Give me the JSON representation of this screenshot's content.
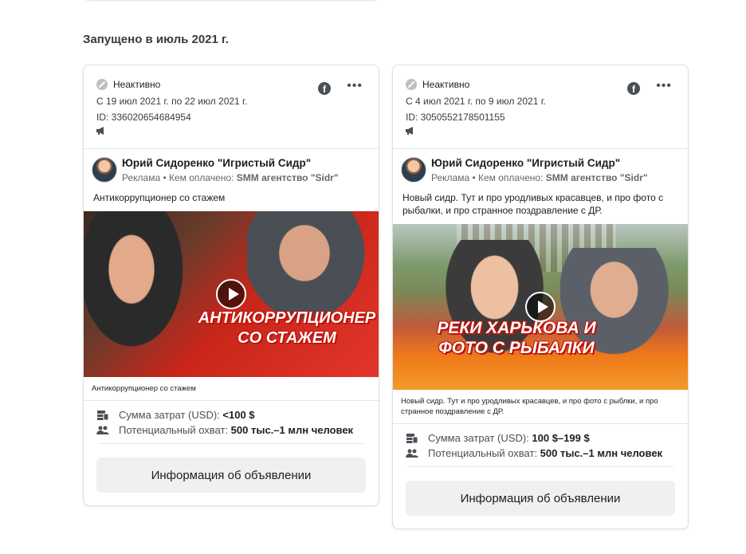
{
  "section_title": "Запущено в июль 2021 г.",
  "cards": [
    {
      "status": "Неактивно",
      "dates": "С 19 июл 2021 г. по 22 июл 2021 г.",
      "id": "ID: 336020654684954",
      "author": "Юрий Сидоренко \"Игристый Сидр\"",
      "sponsored": "Реклама",
      "paid_by_prefix": " • Кем оплачено: ",
      "paid_by": "SMM агентство \"Sidr\"",
      "body": "Антикоррупционер со стажем",
      "overlay": "Антикоррупционер со стажем",
      "caption": "Антикоррупционер со стажем",
      "spend_label": "Сумма затрат (USD): ",
      "spend_value": "<100 $",
      "reach_label": "Потенциальный охват: ",
      "reach_value": "500 тыс.–1 млн человек",
      "button": "Информация об объявлении"
    },
    {
      "status": "Неактивно",
      "dates": "С 4 июл 2021 г. по 9 июл 2021 г.",
      "id": "ID: 3050552178501155",
      "author": "Юрий Сидоренко \"Игристый Сидр\"",
      "sponsored": "Реклама",
      "paid_by_prefix": " • Кем оплачено: ",
      "paid_by": "SMM агентство \"Sidr\"",
      "body": "Новый сидр. Тут и про уродливых красавцев, и про фото с рыбалки, и про странное поздравление с ДР.",
      "overlay": "Реки Харькова и фото с рыбалки",
      "caption": "Новый сидр. Тут и про уродливых красавцев, и про фото с рыблки, и про странное поздравление с ДР.",
      "spend_label": "Сумма затрат (USD): ",
      "spend_value": "100 $–199 $",
      "reach_label": "Потенциальный охват: ",
      "reach_value": "500 тыс.–1 млн человек",
      "button": "Информация об объявлении"
    }
  ],
  "icons": {
    "status": "inactive-icon",
    "platform": "facebook-icon",
    "menu": "more-icon",
    "placement": "megaphone-icon",
    "spend": "money-icon",
    "reach": "people-icon"
  },
  "colors": {
    "overlay_text_shadow": "#c0140b",
    "button_bg": "#f0f0f0"
  }
}
